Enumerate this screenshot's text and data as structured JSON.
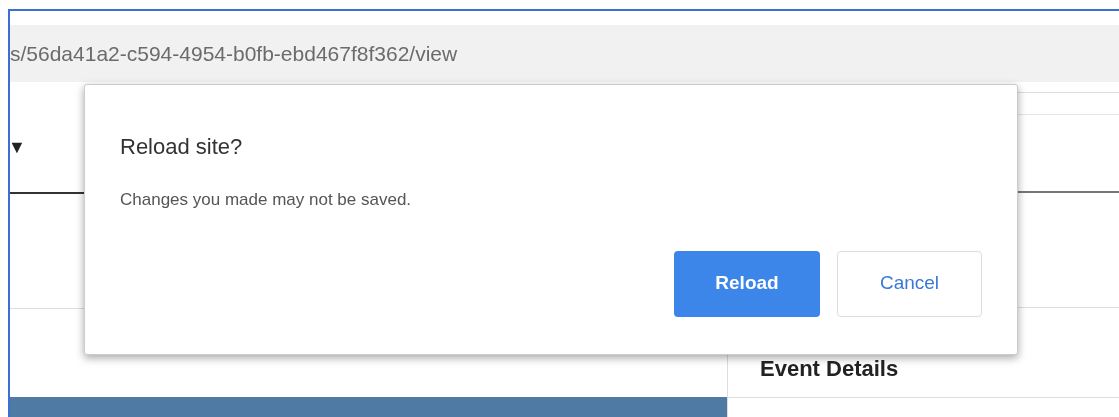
{
  "address_bar": {
    "url": "s/56da41a2-c594-4954-b0fb-ebd467f8f362/view"
  },
  "page": {
    "dropdown_arrow": "▼",
    "side_panel": {
      "title": "Event Details"
    }
  },
  "dialog": {
    "title": "Reload site?",
    "message": "Changes you made may not be saved.",
    "buttons": [
      {
        "label": "Reload",
        "kind": "primary"
      },
      {
        "label": "Cancel",
        "kind": "secondary"
      }
    ]
  }
}
